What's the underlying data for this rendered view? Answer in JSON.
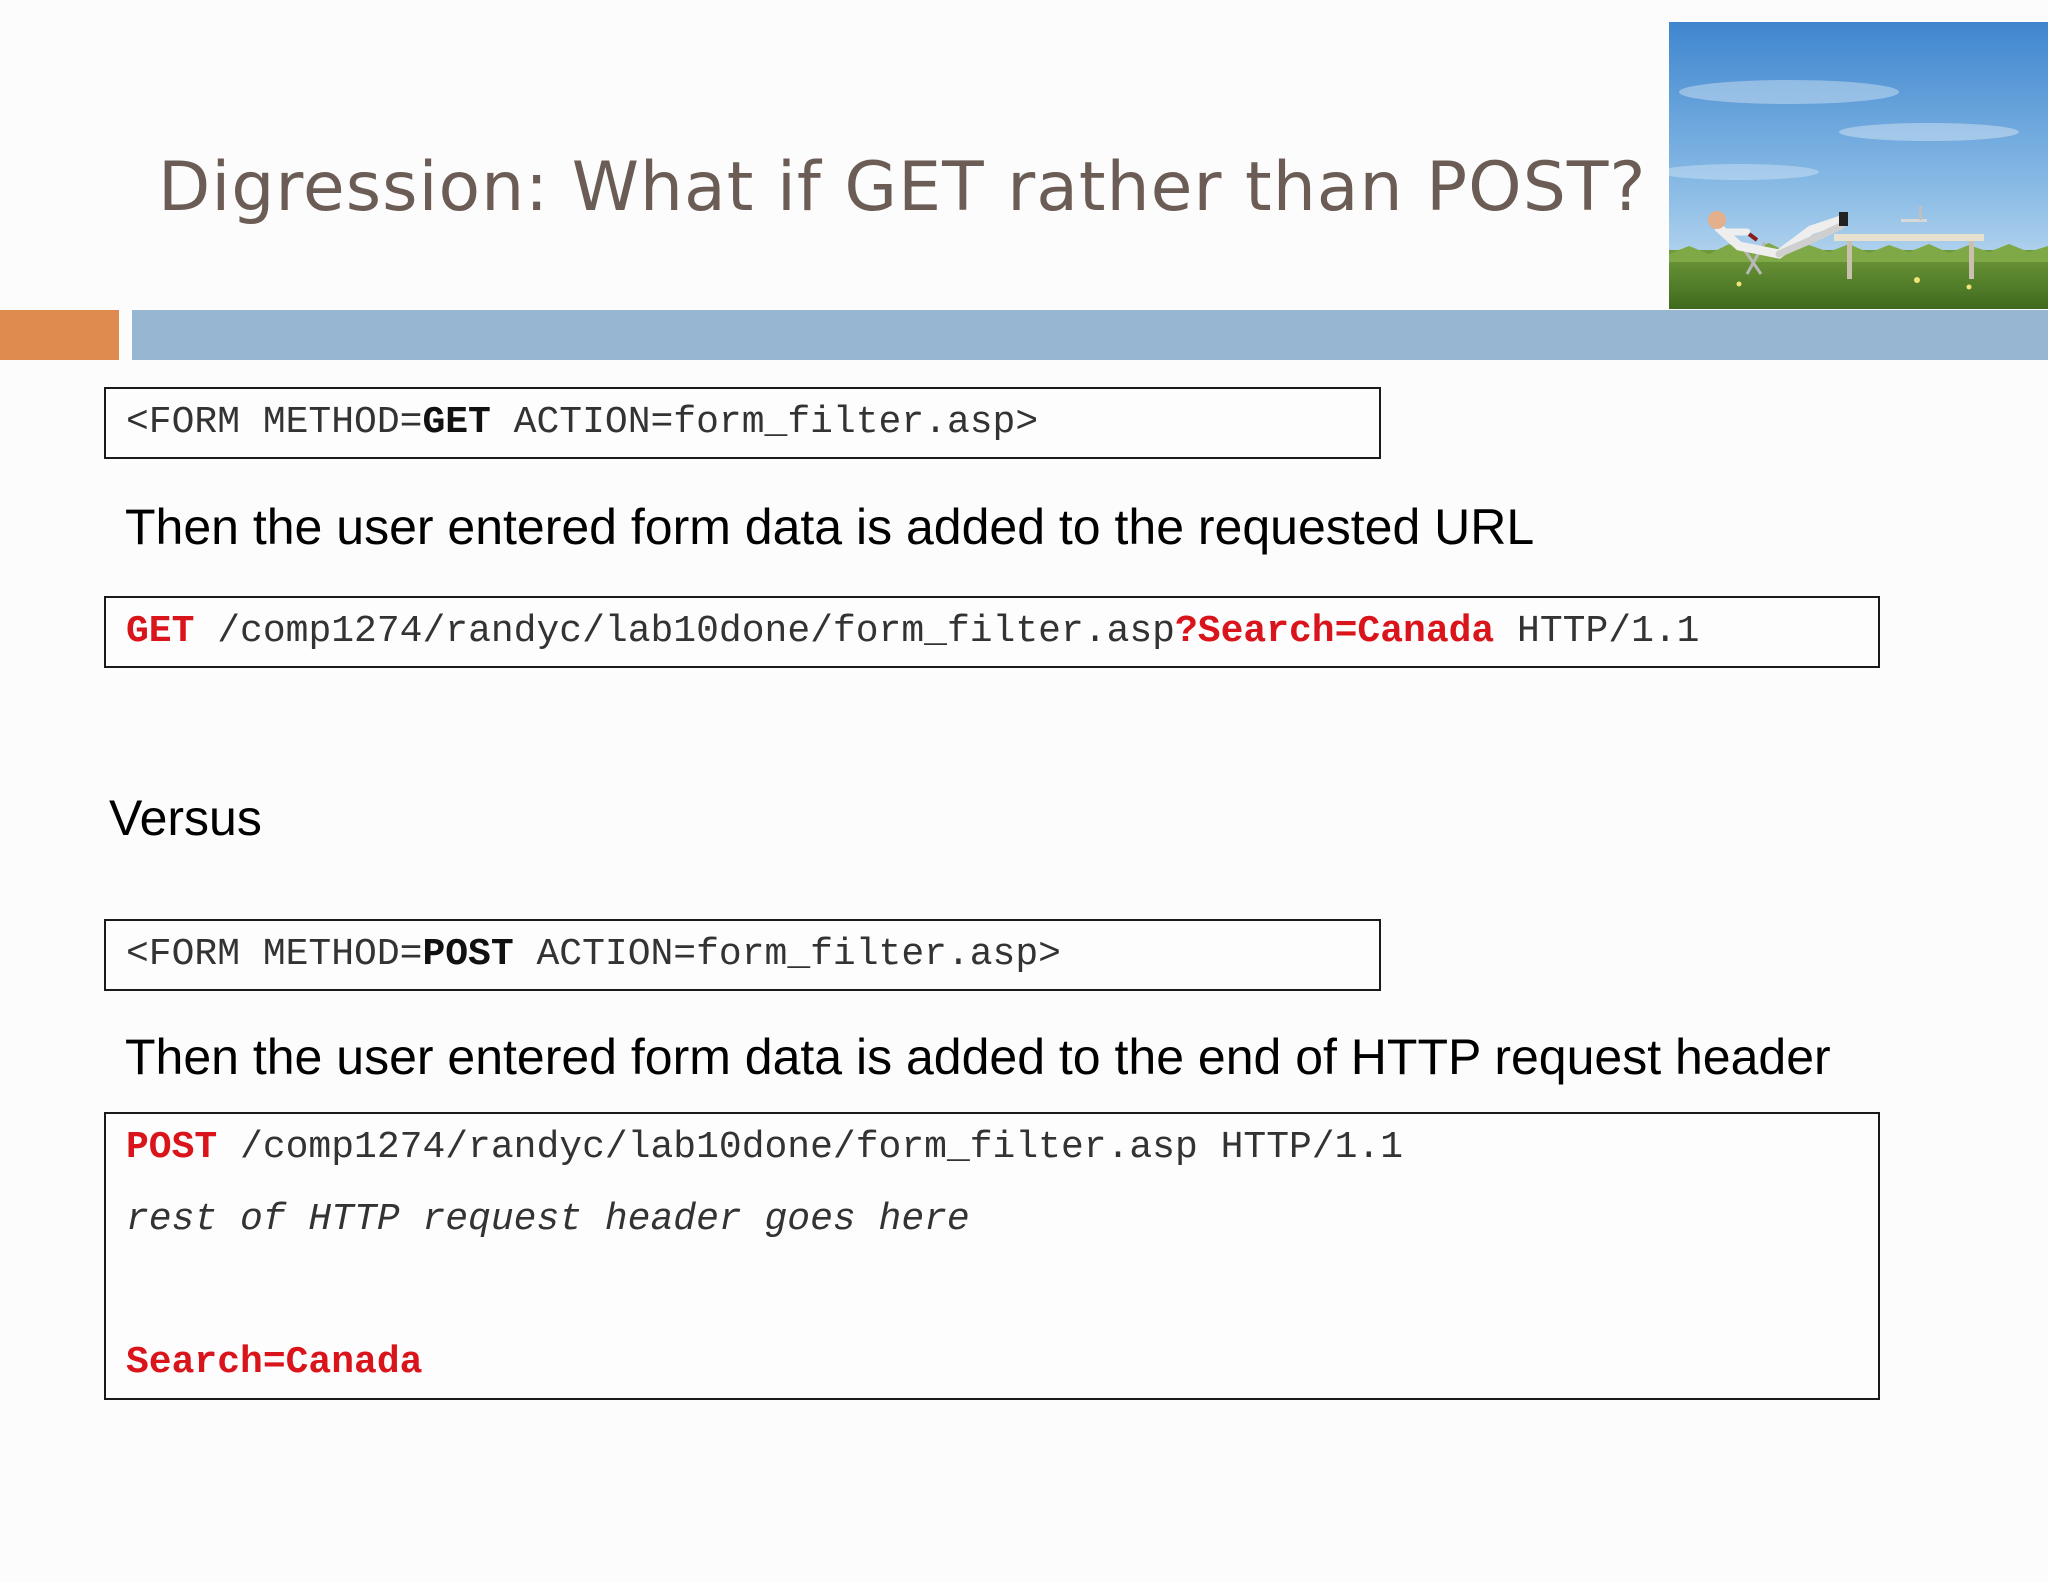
{
  "slide": {
    "title": "Digression: What if GET rather than POST?"
  },
  "photo": {
    "description_icon": "man-relaxing-in-field-photo"
  },
  "colors": {
    "title": "#6b5d55",
    "accent_orange": "#df8a4e",
    "accent_blue": "#97b6d2",
    "highlight_red": "#d9141b"
  },
  "get_form": {
    "prefix": "<FORM METHOD=",
    "method": "GET",
    "suffix": " ACTION=form_filter.asp>"
  },
  "get_explanation": "Then the user entered form data is added to the requested URL",
  "get_request": {
    "method": "GET",
    "path": " /comp1274/randyc/lab10done/form_filter.asp",
    "query": "?Search=Canada",
    "protocol": " HTTP/1.1"
  },
  "versus_label": "Versus",
  "post_form": {
    "prefix": "<FORM METHOD=",
    "method": "POST",
    "suffix": " ACTION=form_filter.asp>"
  },
  "post_explanation": "Then the user entered form data is added to the end of HTTP request header",
  "post_request": {
    "method": "POST",
    "path_protocol": " /comp1274/randyc/lab10done/form_filter.asp HTTP/1.1",
    "header_note": "rest of HTTP request header goes here",
    "body": "Search=Canada"
  }
}
